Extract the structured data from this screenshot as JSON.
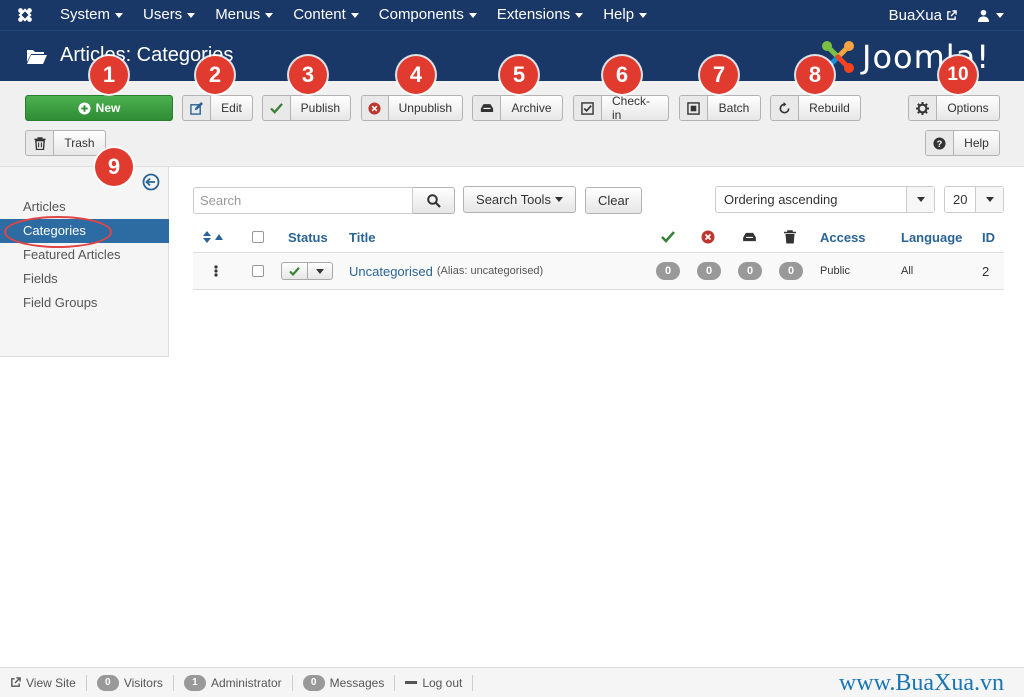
{
  "topnav": {
    "menus": [
      "System",
      "Users",
      "Menus",
      "Content",
      "Components",
      "Extensions",
      "Help"
    ],
    "site_name": "BuaXua"
  },
  "header": {
    "title": "Articles: Categories",
    "brand": "Joomla!"
  },
  "toolbar": {
    "new": "New",
    "edit": "Edit",
    "publish": "Publish",
    "unpublish": "Unpublish",
    "archive": "Archive",
    "checkin": "Check-in",
    "batch": "Batch",
    "rebuild": "Rebuild",
    "options": "Options",
    "trash": "Trash",
    "help": "Help"
  },
  "sidebar": {
    "items": [
      "Articles",
      "Categories",
      "Featured Articles",
      "Fields",
      "Field Groups"
    ],
    "active": "Categories"
  },
  "filters": {
    "search_placeholder": "Search",
    "search_tools": "Search Tools",
    "clear": "Clear",
    "ordering": "Ordering ascending",
    "limit": "20"
  },
  "table": {
    "headers": {
      "status": "Status",
      "title": "Title",
      "access": "Access",
      "language": "Language",
      "id": "ID"
    },
    "rows": [
      {
        "title": "Uncategorised",
        "alias": "(Alias: uncategorised)",
        "published": "0",
        "unpublished": "0",
        "archived": "0",
        "trashed": "0",
        "access": "Public",
        "language": "All",
        "id": "2"
      }
    ]
  },
  "callouts": [
    "1",
    "2",
    "3",
    "4",
    "5",
    "6",
    "7",
    "8",
    "9",
    "10"
  ],
  "statusbar": {
    "view_site": "View Site",
    "visitors_count": "0",
    "visitors": "Visitors",
    "admin_count": "1",
    "admin": "Administrator",
    "messages_count": "0",
    "messages": "Messages",
    "logout": "Log out",
    "watermark": "www.BuaXua.vn"
  },
  "colors": {
    "navy": "#1a3867",
    "green": "#2f8c34",
    "active_blue": "#2d6ca2",
    "callout_red": "#e03b2e"
  }
}
